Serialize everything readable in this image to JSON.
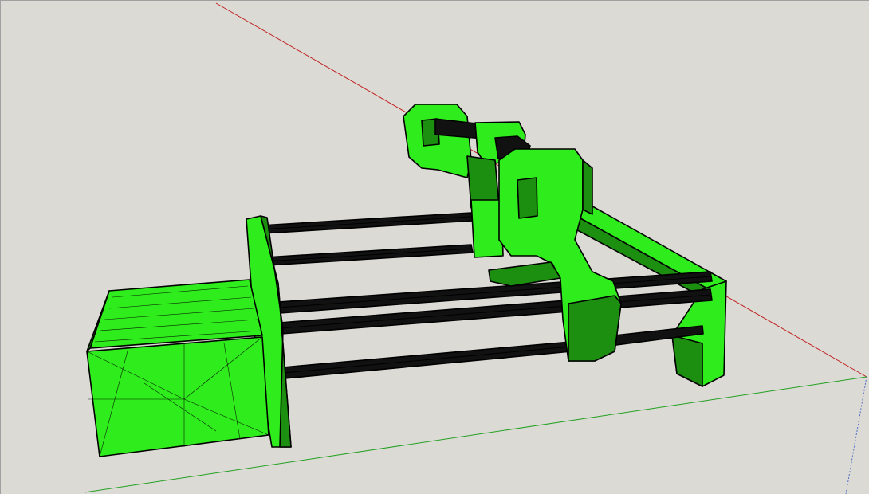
{
  "viewport": {
    "background_color": "#dcdad5",
    "model_color": "#2fed1c",
    "model_dark_color": "#1c8f10",
    "edge_color": "#000000",
    "axes": {
      "red_axis_color": "#c02020",
      "green_axis_color": "#22a022",
      "blue_axis_color": "#5070c8"
    }
  }
}
